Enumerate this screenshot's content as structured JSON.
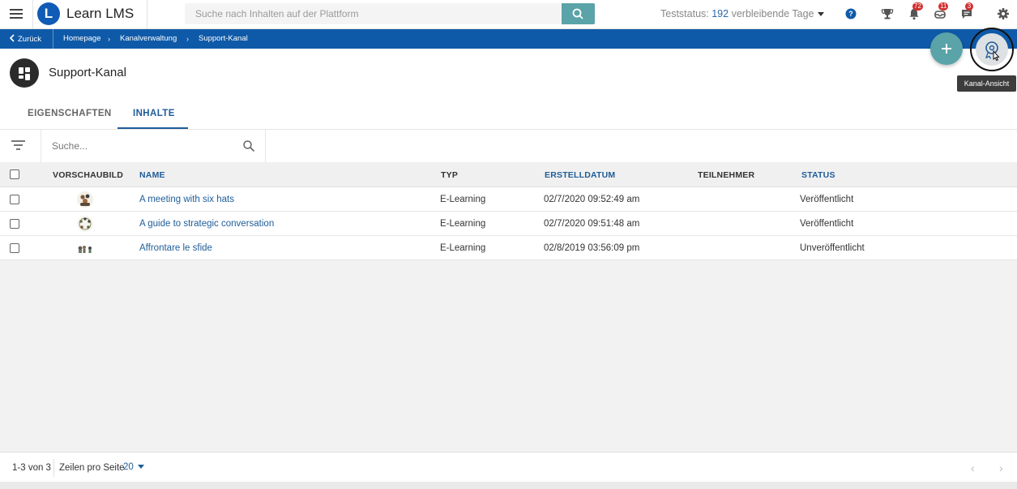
{
  "topbar": {
    "app_name": "Learn LMS",
    "logo_letter": "L",
    "search_placeholder": "Suche nach Inhalten auf der Plattform",
    "trial_prefix": "Teststatus:",
    "trial_days": "192",
    "trial_suffix": "verbleibende Tage",
    "badges": {
      "notifications": "72",
      "messages": "11",
      "chat": "3"
    },
    "icons": [
      "menu-icon",
      "search-icon",
      "help-icon",
      "trophy-icon",
      "bell-icon",
      "inbox-icon",
      "chat-icon",
      "gear-icon"
    ],
    "accent_color": "#0f5aa8",
    "search_button_color": "#5aa3a8"
  },
  "breadcrumb": {
    "back": "Zurück",
    "items": [
      "Homepage",
      "Kanalverwaltung",
      "Support-Kanal"
    ]
  },
  "page": {
    "title": "Support-Kanal",
    "tooltip": "Kanal-Ansicht",
    "tabs": [
      {
        "label": "EIGENSCHAFTEN",
        "active": false
      },
      {
        "label": "INHALTE",
        "active": true
      }
    ]
  },
  "filter": {
    "search_placeholder": "Suche..."
  },
  "table": {
    "columns": [
      "VORSCHAUBILD",
      "NAME",
      "TYP",
      "ERSTELLDATUM",
      "TEILNEHMER",
      "STATUS"
    ],
    "rows": [
      {
        "name": "A meeting with six hats",
        "type": "E-Learning",
        "date": "02/7/2020 09:52:49 am",
        "participants": "",
        "status": "Veröffentlicht"
      },
      {
        "name": "A guide to strategic conversation",
        "type": "E-Learning",
        "date": "02/7/2020 09:51:48 am",
        "participants": "",
        "status": "Veröffentlicht"
      },
      {
        "name": "Affrontare le sfide",
        "type": "E-Learning",
        "date": "02/8/2019 03:56:09 pm",
        "participants": "",
        "status": "Unveröffentlicht"
      }
    ]
  },
  "footer": {
    "range": "1-3 von 3",
    "rows_per_page_label": "Zeilen pro Seite",
    "rows_per_page": "20"
  }
}
